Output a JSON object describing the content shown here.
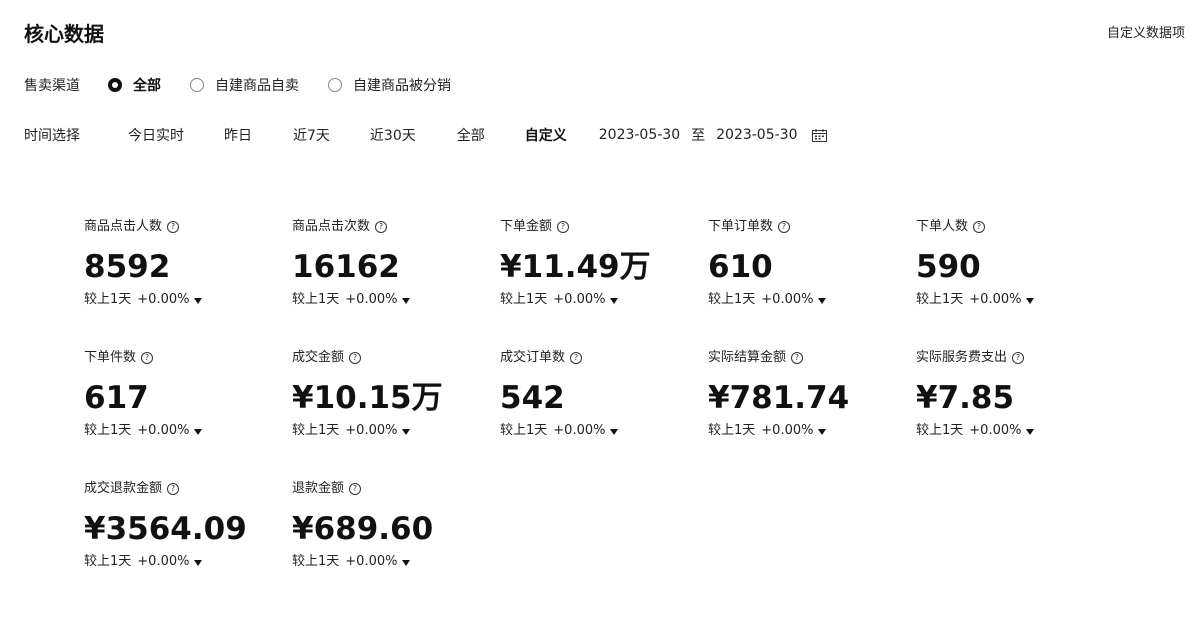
{
  "header": {
    "title": "核心数据",
    "customize_label": "自定义数据项"
  },
  "channel": {
    "label": "售卖渠道",
    "options": [
      {
        "label": "全部",
        "checked": true
      },
      {
        "label": "自建商品自卖",
        "checked": false
      },
      {
        "label": "自建商品被分销",
        "checked": false
      }
    ]
  },
  "time": {
    "label": "时间选择",
    "tabs": [
      "今日实时",
      "昨日",
      "近7天",
      "近30天",
      "全部",
      "自定义"
    ],
    "active_tab": "自定义",
    "start_date": "2023-05-30",
    "separator": "至",
    "end_date": "2023-05-30"
  },
  "metrics": [
    {
      "label": "商品点击人数",
      "value": "8592",
      "compare_label": "较上1天",
      "compare_value": "+0.00%"
    },
    {
      "label": "商品点击次数",
      "value": "16162",
      "compare_label": "较上1天",
      "compare_value": "+0.00%"
    },
    {
      "label": "下单金额",
      "value": "¥11.49万",
      "compare_label": "较上1天",
      "compare_value": "+0.00%"
    },
    {
      "label": "下单订单数",
      "value": "610",
      "compare_label": "较上1天",
      "compare_value": "+0.00%"
    },
    {
      "label": "下单人数",
      "value": "590",
      "compare_label": "较上1天",
      "compare_value": "+0.00%"
    },
    {
      "label": "下单件数",
      "value": "617",
      "compare_label": "较上1天",
      "compare_value": "+0.00%"
    },
    {
      "label": "成交金额",
      "value": "¥10.15万",
      "compare_label": "较上1天",
      "compare_value": "+0.00%"
    },
    {
      "label": "成交订单数",
      "value": "542",
      "compare_label": "较上1天",
      "compare_value": "+0.00%"
    },
    {
      "label": "实际结算金额",
      "value": "¥781.74",
      "compare_label": "较上1天",
      "compare_value": "+0.00%"
    },
    {
      "label": "实际服务费支出",
      "value": "¥7.85",
      "compare_label": "较上1天",
      "compare_value": "+0.00%"
    },
    {
      "label": "成交退款金额",
      "value": "¥3564.09",
      "compare_label": "较上1天",
      "compare_value": "+0.00%"
    },
    {
      "label": "退款金额",
      "value": "¥689.60",
      "compare_label": "较上1天",
      "compare_value": "+0.00%"
    }
  ],
  "icons": {
    "help": "question-circle-icon",
    "calendar": "calendar-icon",
    "trend": "caret-down-icon"
  }
}
